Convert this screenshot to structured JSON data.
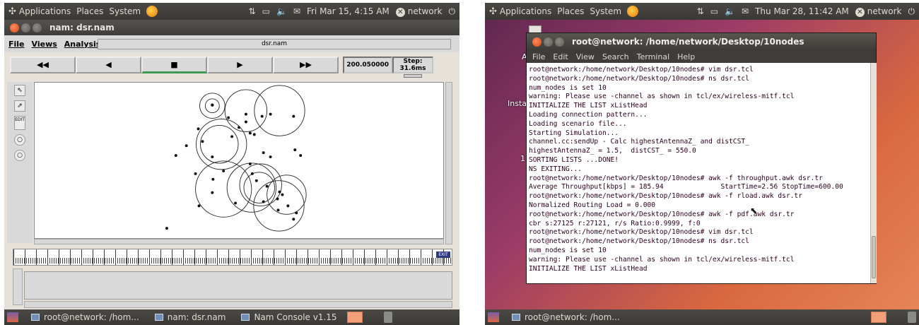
{
  "left_screen": {
    "top_panel": {
      "menus": [
        "Applications",
        "Places",
        "System"
      ],
      "datetime": "Fri Mar 15,  4:15 AM",
      "user": "network"
    },
    "nam_window": {
      "title": "nam: dsr.nam",
      "menus": [
        "File",
        "Views",
        "Analysis"
      ],
      "file_field": "dsr.nam",
      "controls": {
        "rewind": "◀◀",
        "back": "◀",
        "stop": "■",
        "play": "▶",
        "fast_forward": "▶▶",
        "time": "200.050000",
        "step": "Step: 31.6ms"
      },
      "tools": [
        "⇖",
        "⇗",
        "EDIT",
        "○",
        "○"
      ],
      "timeline_badge": "EXIT"
    },
    "bottom_panel": {
      "tasks": [
        "root@network: /hom...",
        "nam: dsr.nam",
        "Nam Console v1.15"
      ]
    }
  },
  "right_screen": {
    "top_panel": {
      "menus": [
        "Applications",
        "Places",
        "System"
      ],
      "datetime": "Thu Mar 28, 11:42 AM",
      "user": "network"
    },
    "desktop_labels": [
      "A",
      "Insta",
      "1"
    ],
    "terminal": {
      "title": "root@network: /home/network/Desktop/10nodes",
      "menus": [
        "File",
        "Edit",
        "View",
        "Search",
        "Terminal",
        "Help"
      ],
      "lines": [
        "root@network:/home/network/Desktop/10nodes# vim dsr.tcl",
        "root@network:/home/network/Desktop/10nodes# ns dsr.tcl",
        "num_nodes is set 10",
        "warning: Please use -channel as shown in tcl/ex/wireless-mitf.tcl",
        "INITIALIZE THE LIST xListHead",
        "Loading connection pattern...",
        "Loading scenario file...",
        "Starting Simulation...",
        "channel.cc:sendUp - Calc highestAntennaZ_ and distCST_",
        "highestAntennaZ_ = 1.5,  distCST_ = 550.0",
        "SORTING LISTS ...DONE!",
        "NS EXITING...",
        "root@network:/home/network/Desktop/10nodes# awk -f throughput.awk dsr.tr",
        "Average Throughput[kbps] = 185.94              StartTime=2.56 StopTime=600.00",
        "root@network:/home/network/Desktop/10nodes# awk -f rload.awk dsr.tr",
        "Normalized Routing Load = 0.000",
        "root@network:/home/network/Desktop/10nodes# awk -f pdf.awk dsr.tr",
        "cbr s:27125 r:27121, r/s Ratio:0.9999, f:0",
        "root@network:/home/network/Desktop/10nodes# vim dsr.tcl",
        "root@network:/home/network/Desktop/10nodes# ns dsr.tcl",
        "num_nodes is set 10",
        "warning: Please use -channel as shown in tcl/ex/wireless-mitf.tcl",
        "INITIALIZE THE LIST xListHead"
      ]
    },
    "bottom_panel": {
      "tasks": [
        "root@network: /hom..."
      ]
    }
  }
}
